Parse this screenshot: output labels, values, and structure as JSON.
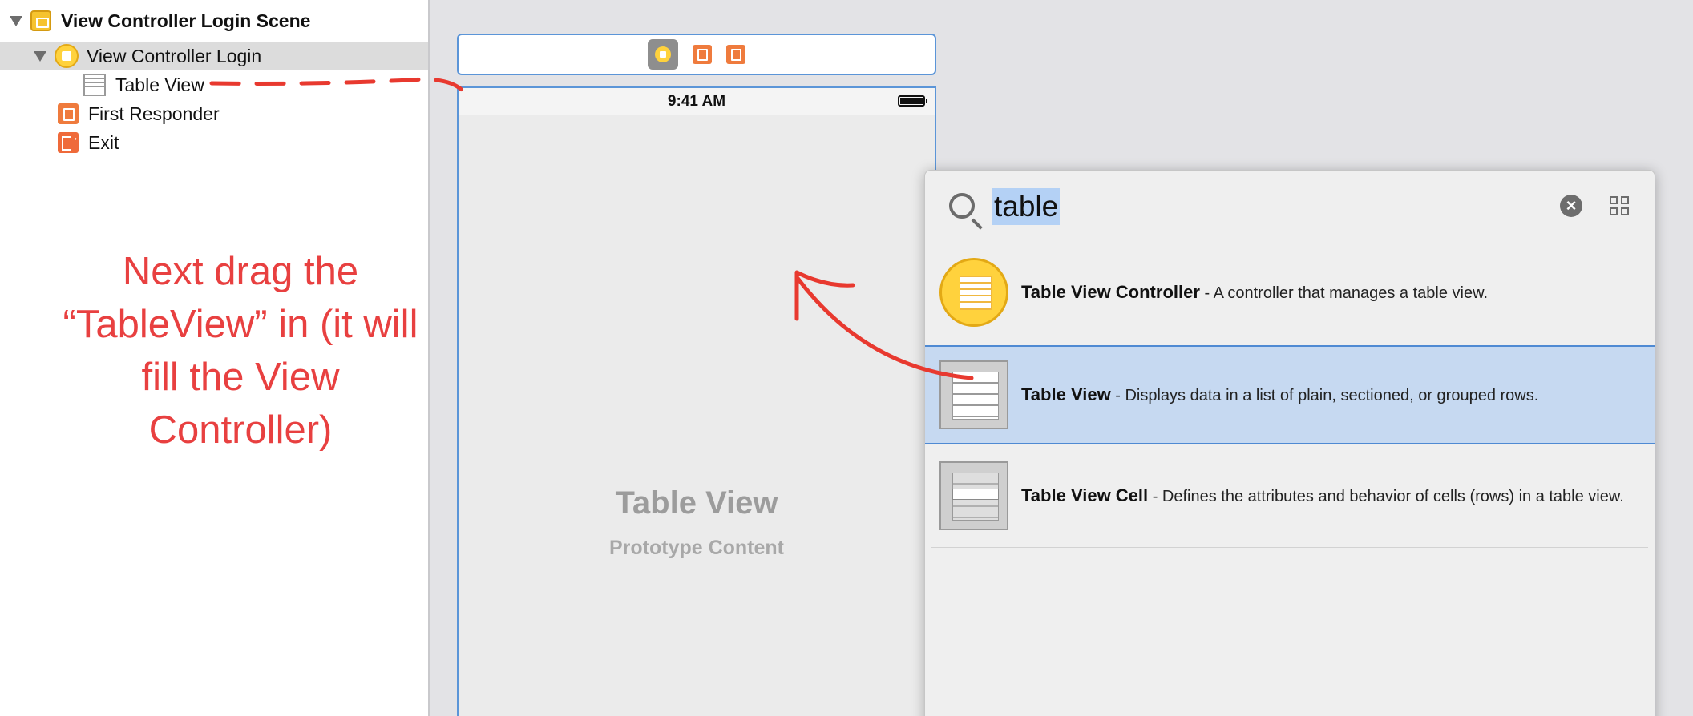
{
  "outline": {
    "items": [
      {
        "label": "View Controller Login Scene",
        "icon": "scene-icon",
        "bold": true
      },
      {
        "label": "View Controller Login",
        "icon": "view-controller-icon",
        "selected": true
      },
      {
        "label": "Table View",
        "icon": "table-view-icon"
      },
      {
        "label": "First Responder",
        "icon": "first-responder-icon"
      },
      {
        "label": "Exit",
        "icon": "exit-icon"
      }
    ]
  },
  "annotation": {
    "text": "Next drag the “TableView” in (it will fill the View Controller)",
    "color": "#e84040"
  },
  "canvas": {
    "status_time": "9:41 AM",
    "placeholder_title": "Table View",
    "placeholder_subtitle": "Prototype Content",
    "dock_icons": [
      "view-controller-icon",
      "first-responder-icon",
      "exit-icon"
    ]
  },
  "library": {
    "search_value": "table",
    "items": [
      {
        "name": "Table View Controller",
        "description": " - A controller that manages a table view.",
        "icon": "table-view-controller-icon"
      },
      {
        "name": "Table View",
        "description": " - Displays data in a list of plain, sectioned, or grouped rows.",
        "icon": "table-view-icon",
        "selected": true
      },
      {
        "name": "Table View Cell",
        "description": " - Defines the attributes and behavior of cells (rows) in a table view.",
        "icon": "table-view-cell-icon"
      }
    ]
  },
  "colors": {
    "accent": "#5b95d8",
    "selection": "#c6d9f1",
    "annotation": "#e84040"
  }
}
